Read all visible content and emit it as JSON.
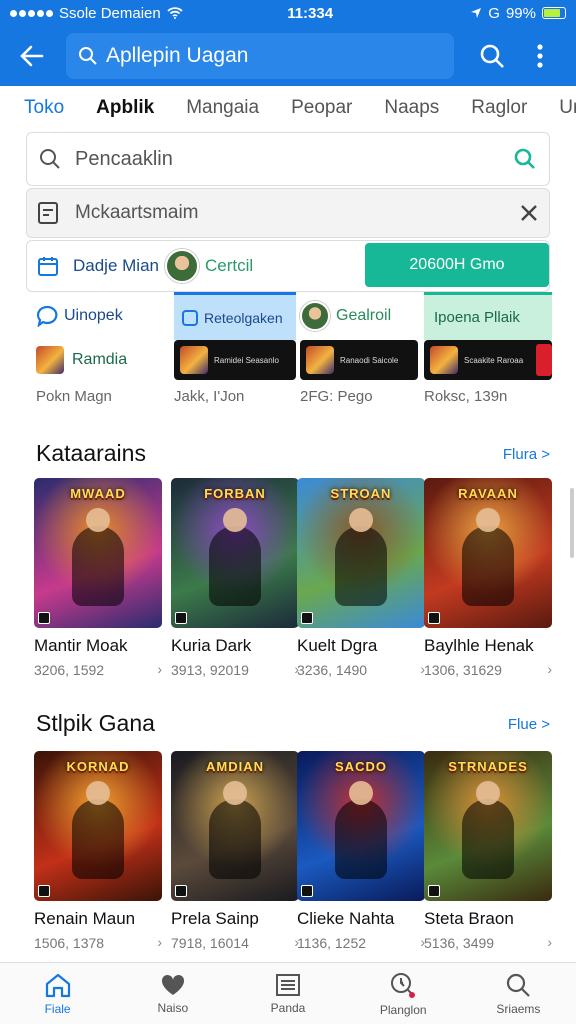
{
  "status": {
    "carrier": "Ssole Demaien",
    "time": "11:334",
    "battery": "99%",
    "g_label": "G"
  },
  "header": {
    "search_text": "Apllepin Uagan"
  },
  "tabs": [
    "Toko",
    "Apblik",
    "Mangaia",
    "Peopar",
    "Naaps",
    "Raglor",
    "Ur"
  ],
  "search": {
    "placeholder": "Pencaaklin"
  },
  "suggestion": {
    "text": "Mckaartsmaim"
  },
  "account": {
    "label": "Dadje Mian",
    "name": "Certcil",
    "button": "20600H Gmo"
  },
  "promos": [
    {
      "title": "Uinopek",
      "sub": "Ramdia",
      "meta": "Pokn Magn"
    },
    {
      "title": "Reteolgaken",
      "tile_text": "Ramidei Seasanlo",
      "meta": "Jakk, I'Jon"
    },
    {
      "title": "Gealroil",
      "tile_text": "Ranaodi Saicole",
      "meta": "2FG: Pego"
    },
    {
      "title": "Ipoena Pllaik",
      "tile_text": "Scaakite Raroaa",
      "meta": "Roksc, 139n"
    }
  ],
  "section1": {
    "title": "Kataarains",
    "more": "Flura >",
    "games": [
      {
        "name": "Mantir Moak",
        "meta": "3206, 1592",
        "logo": "MWAAD",
        "colors": [
          "#2a2c6e",
          "#c73a8c",
          "#e38a2a"
        ]
      },
      {
        "name": "Kuria Dark",
        "meta": "3913, 92019",
        "logo": "FORBAN",
        "colors": [
          "#1c2a3a",
          "#3b7a4a",
          "#8a4ac0"
        ]
      },
      {
        "name": "Kuelt Dgra",
        "meta": "3236, 1490",
        "logo": "STROAN",
        "colors": [
          "#3b8ad8",
          "#6aa84f",
          "#8b5a2b"
        ]
      },
      {
        "name": "Baylhle Henak",
        "meta": "1306, 31629",
        "logo": "RAVAAN",
        "colors": [
          "#5a1a10",
          "#c23a20",
          "#e8a040"
        ]
      }
    ]
  },
  "section2": {
    "title": "Stlpik Gana",
    "more": "Flue >",
    "games": [
      {
        "name": "Renain Maun",
        "meta": "1506, 1378",
        "logo": "KORNAD",
        "colors": [
          "#3a1408",
          "#c23018",
          "#f0a030"
        ]
      },
      {
        "name": "Prela Sainp",
        "meta": "7918, 16014",
        "logo": "AMDIAN",
        "colors": [
          "#1a1a20",
          "#5a4a3a",
          "#c8a050"
        ]
      },
      {
        "name": "Clieke Nahta",
        "meta": "1136, 1252",
        "logo": "SACDO",
        "colors": [
          "#0a1a5a",
          "#1a5ac0",
          "#c03030"
        ]
      },
      {
        "name": "Steta Braon",
        "meta": "5136, 3499",
        "logo": "STRNADES",
        "colors": [
          "#3a2a10",
          "#5a8a3a",
          "#d89038"
        ]
      }
    ]
  },
  "bottom_nav": [
    {
      "label": "Fiale",
      "icon": "home-icon"
    },
    {
      "label": "Naiso",
      "icon": "heart-icon"
    },
    {
      "label": "Panda",
      "icon": "list-icon"
    },
    {
      "label": "Planglon",
      "icon": "clock-search-icon"
    },
    {
      "label": "Sriaems",
      "icon": "search-icon"
    }
  ],
  "colors": {
    "primary": "#1677e0",
    "accent": "#17b897"
  }
}
